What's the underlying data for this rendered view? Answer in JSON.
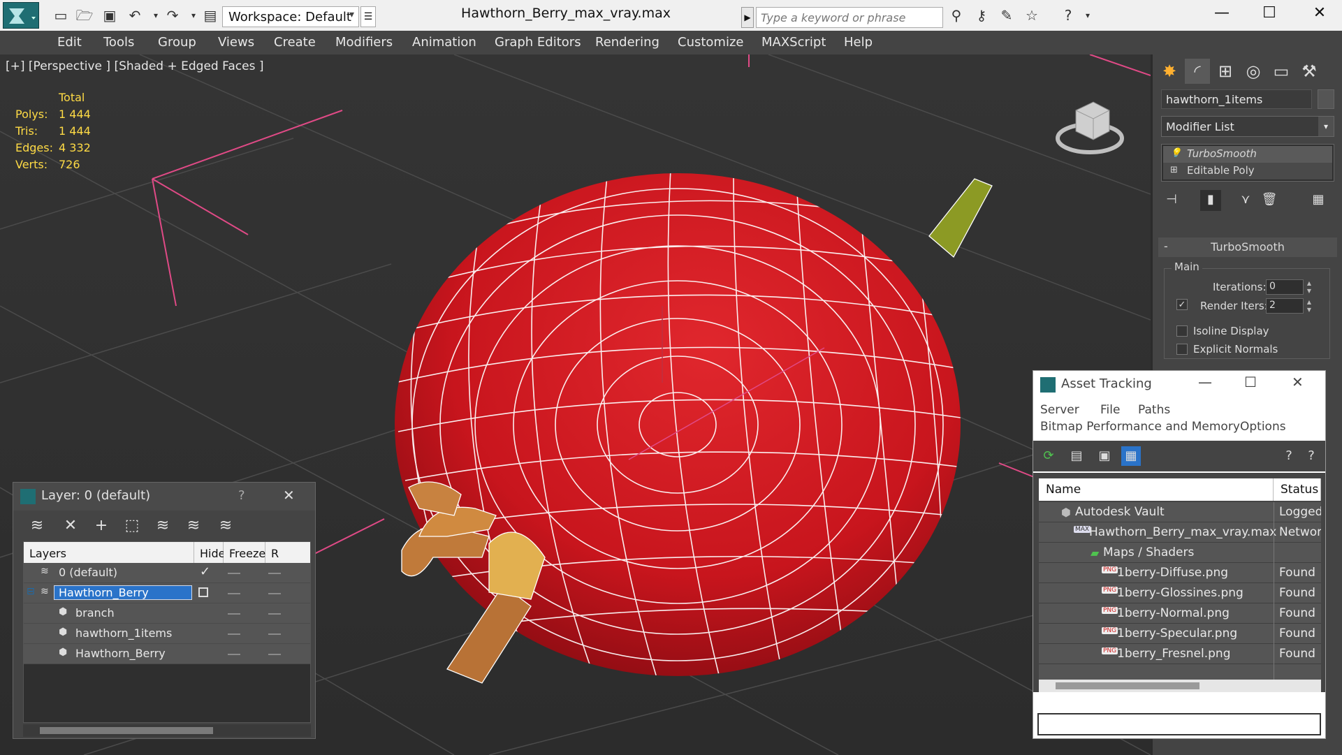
{
  "window": {
    "title": "Hawthorn_Berry_max_vray.max",
    "workspace_label": "Workspace: Default",
    "search_placeholder": "Type a keyword or phrase"
  },
  "menu": [
    "Edit",
    "Tools",
    "Group",
    "Views",
    "Create",
    "Modifiers",
    "Animation",
    "Graph Editors",
    "Rendering",
    "Customize",
    "MAXScript",
    "Help"
  ],
  "viewport": {
    "label": "[+] [Perspective ] [Shaded + Edged Faces ]",
    "stats": {
      "header": "Total",
      "rows": [
        {
          "label": "Polys:",
          "value": "1 444"
        },
        {
          "label": "Tris:",
          "value": "1 444"
        },
        {
          "label": "Edges:",
          "value": "4 332"
        },
        {
          "label": "Verts:",
          "value": "726"
        }
      ]
    },
    "colors": {
      "berry": "#c8151d",
      "wire": "#ffffff",
      "stem": "#c07a3a",
      "leaf": "#8c9a24",
      "grid": "#555555",
      "pink": "#e04a86"
    }
  },
  "command_panel": {
    "object_name": "hawthorn_1items",
    "modifier_list": "Modifier List",
    "stack": [
      {
        "label": "TurboSmooth",
        "icon": "lightbulb-icon"
      },
      {
        "label": "Editable Poly",
        "icon": "plus-box-icon"
      }
    ],
    "turbosmooth": {
      "header": "TurboSmooth",
      "group": "Main",
      "iterations_label": "Iterations:",
      "iterations_value": "0",
      "render_iters_label": "Render Iters:",
      "render_iters_value": "2",
      "isoline_label": "Isoline Display",
      "explicit_label": "Explicit Normals"
    }
  },
  "layer_panel": {
    "title": "Layer: 0 (default)",
    "help": "?",
    "columns": [
      "Layers",
      "Hide",
      "Freeze",
      "R"
    ],
    "rows": [
      {
        "name": "0 (default)",
        "indent": 1
      },
      {
        "name": "Hawthorn_Berry",
        "indent": 1
      },
      {
        "name": "branch",
        "indent": 2
      },
      {
        "name": "hawthorn_1items",
        "indent": 2
      },
      {
        "name": "Hawthorn_Berry",
        "indent": 2
      }
    ]
  },
  "asset_panel": {
    "title": "Asset Tracking",
    "menu_row1": [
      "Server",
      "File",
      "Paths"
    ],
    "menu_row2": [
      "Bitmap Performance and Memory",
      "Options"
    ],
    "columns": [
      "Name",
      "Status"
    ],
    "rows": [
      {
        "name": "Autodesk Vault",
        "status": "Logged C",
        "indent": 0
      },
      {
        "name": "Hawthorn_Berry_max_vray.max",
        "status": "Network",
        "indent": 1
      },
      {
        "name": "Maps / Shaders",
        "status": "",
        "indent": 2
      },
      {
        "name": "1berry-Diffuse.png",
        "status": "Found",
        "indent": 3
      },
      {
        "name": "1berry-Glossines.png",
        "status": "Found",
        "indent": 3
      },
      {
        "name": "1berry-Normal.png",
        "status": "Found",
        "indent": 3
      },
      {
        "name": "1berry-Specular.png",
        "status": "Found",
        "indent": 3
      },
      {
        "name": "1berry_Fresnel.png",
        "status": "Found",
        "indent": 3
      }
    ],
    "png_badge": "PNG",
    "max_badge": "MAX"
  }
}
